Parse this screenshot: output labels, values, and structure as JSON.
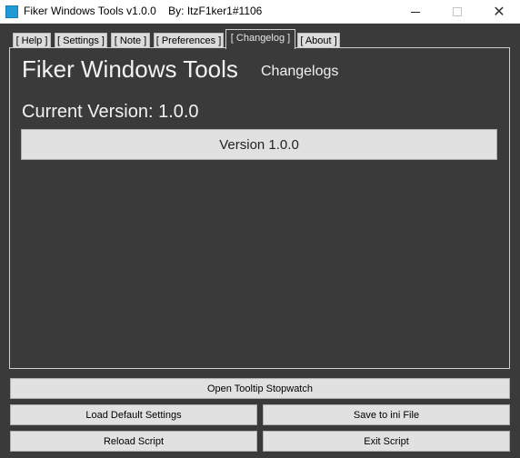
{
  "window": {
    "title": "Fiker Windows Tools v1.0.0    By: ItzF1ker1#1106",
    "minimize_glyph": "",
    "maximize_glyph": "",
    "close_glyph": "✕"
  },
  "tabs": [
    {
      "label": "[ Help ]",
      "active": false
    },
    {
      "label": "[ Settings ]",
      "active": false
    },
    {
      "label": "[ Note ]",
      "active": false
    },
    {
      "label": "[ Preferences ]",
      "active": false
    },
    {
      "label": "[ Changelog ]",
      "active": true
    },
    {
      "label": "[ About ]",
      "active": false
    }
  ],
  "changelog": {
    "heading": "Fiker Windows Tools",
    "subheading": "Changelogs",
    "current_version": "Current Version: 1.0.0",
    "version_button": "Version 1.0.0"
  },
  "buttons": {
    "open_tooltip_stopwatch": "Open Tooltip Stopwatch",
    "load_default_settings": "Load Default Settings",
    "save_to_ini_file": "Save to ini File",
    "reload_script": "Reload Script",
    "exit_script": "Exit Script"
  },
  "colors": {
    "background": "#3b3a3a",
    "button_face": "#e1e1e1",
    "app_icon": "#1e9bd7"
  }
}
